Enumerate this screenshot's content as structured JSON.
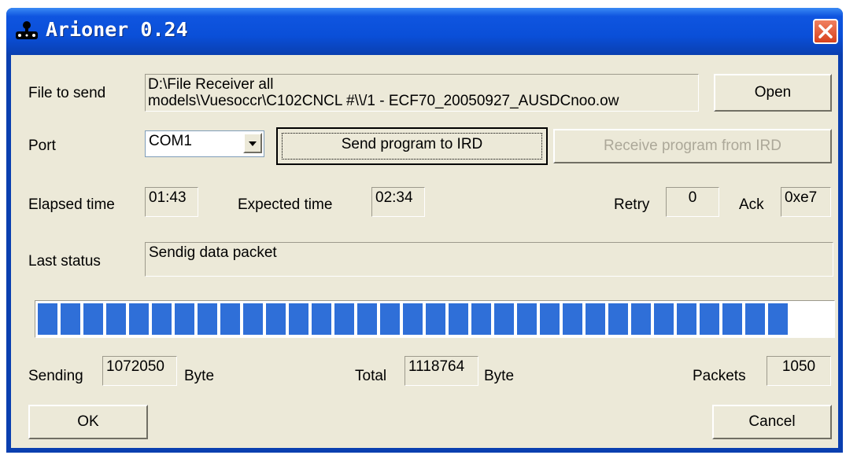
{
  "window": {
    "title": "Arioner 0.24",
    "colors": {
      "title_bar": "#0a4fd8",
      "client": "#ece9d8",
      "progress": "#2f6fd8",
      "close": "#d7421e"
    }
  },
  "file": {
    "label": "File to send",
    "path_line1": "D:\\File Receiver all",
    "path_line2": "models\\Vuesoccr\\C102CNCL #\\\\/1 - ECF70_20050927_AUSDCnoo.ow",
    "open_label": "Open"
  },
  "port": {
    "label": "Port",
    "selected": "COM1",
    "send_label": "Send program to IRD",
    "receive_label": "Receive program from IRD"
  },
  "timing": {
    "elapsed_label": "Elapsed time",
    "elapsed_value": "01:43",
    "expected_label": "Expected time",
    "expected_value": "02:34",
    "retry_label": "Retry",
    "retry_value": "0",
    "ack_label": "Ack",
    "ack_value": "0xe7"
  },
  "status": {
    "label": "Last status",
    "value": "Sendig data packet"
  },
  "progress": {
    "fraction": 0.958
  },
  "stats": {
    "sending_label": "Sending",
    "sending_value": "1072050",
    "sending_unit": "Byte",
    "total_label": "Total",
    "total_value": "1118764",
    "total_unit": "Byte",
    "packets_label": "Packets",
    "packets_value": "1050"
  },
  "buttons": {
    "ok_label": "OK",
    "cancel_label": "Cancel"
  },
  "icons": {
    "app": "joystick-icon",
    "close": "close-icon"
  }
}
